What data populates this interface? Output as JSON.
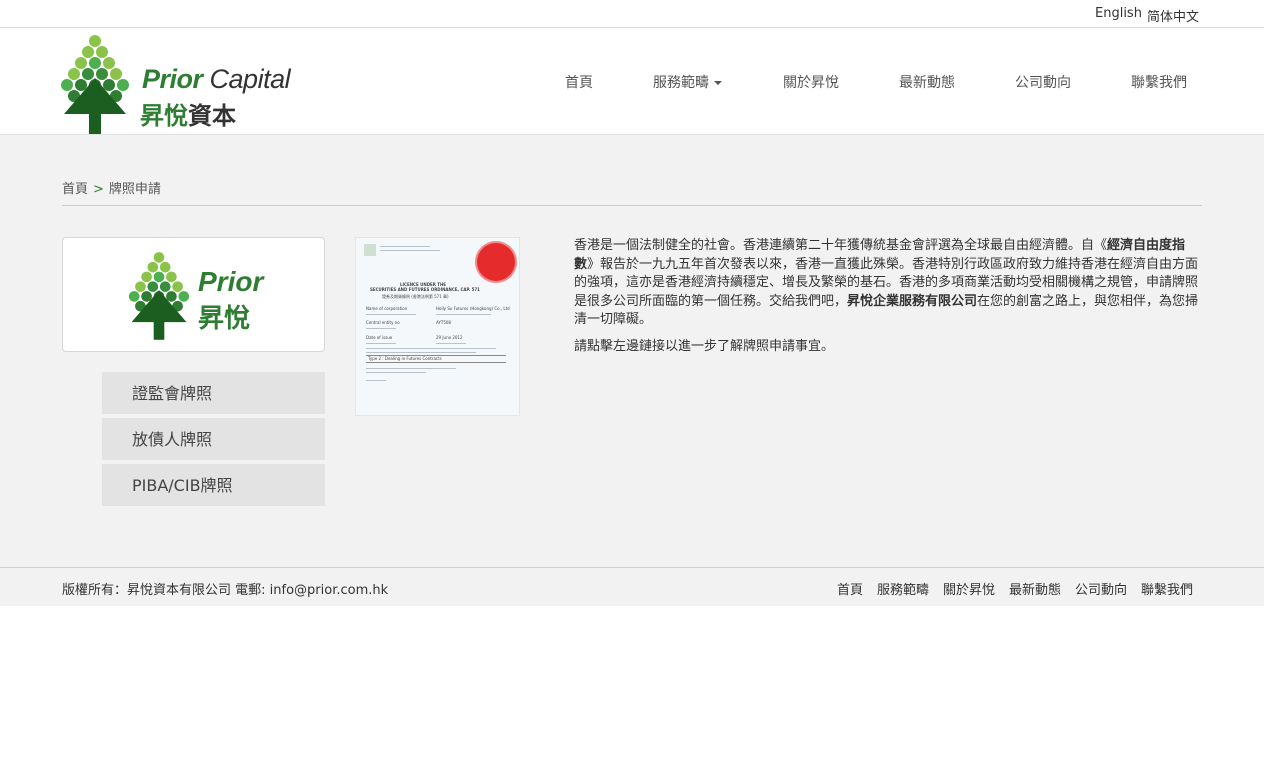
{
  "top_bar": {
    "english": "English",
    "simplified": "简体中文"
  },
  "header": {
    "logo_title": "Prior",
    "logo_title_2": "Capital",
    "logo_cn": "昇悅",
    "logo_cn_2": "資本",
    "nav": [
      "首頁",
      "服務範疇",
      "關於昇悅",
      "最新動態",
      "公司動向",
      "聯繫我們"
    ]
  },
  "breadcrumb": {
    "home": "首頁",
    "separator": ">",
    "current": "牌照申請"
  },
  "side_logo": {
    "title": "Prior",
    "cn": "昇悅"
  },
  "side_menu": [
    "證監會牌照",
    "放債人牌照",
    "PIBA/CIB牌照"
  ],
  "certificate": {
    "heading_1": "LICENCE UNDER THE",
    "heading_2": "SECURITIES AND FUTURES ORDINANCE, CAP. 571",
    "heading_cn": "證券及期貨條例 (香港法例第 571 章)",
    "row_1_label": "Name of corporation",
    "row_1_value": "Holly Su Futures (Hongkong) Co., Ltd",
    "row_2_label": "Central entity no",
    "row_2_value": "AYT508",
    "row_3_label": "Date of issue",
    "row_3_value": "29 June 2012",
    "row_4_label": "Type 2 : Dealing in Futures Contracts"
  },
  "content": {
    "p1_a": " 香港是一個法制健全的社會。香港連續第二十年獲傳統基金會評選為全球最自由經濟體。自《",
    "p1_b": "經濟自由度指數",
    "p1_c": "》報告於一九九五年首次發表以來，香港一直獲此殊榮。香港特別行政區政府致力維持香港在經濟自由方面的強項，這亦是香港經濟持續穩定、增長及繁榮的基石。香港的多項商業活動均受相關機構之規管，申請牌照是很多公司所面臨的第一個任務。交給我們吧，",
    "p1_d": "昇悅企業服務有限公司",
    "p1_e": "在您的創富之路上，與您相伴，為您掃清一切障礙。",
    "p2": "請點擊左邊鏈接以進一步了解牌照申請事宜。"
  },
  "footer": {
    "copyright": "版權所有：昇悅資本有限公司  電郵: info@prior.com.hk",
    "links": [
      "首頁",
      "服務範疇",
      "關於昇悅",
      "最新動態",
      "公司動向",
      "聯繫我們"
    ]
  },
  "colors": {
    "brand_green": "#2e7d32",
    "light_green": "#8bc34a",
    "seal_red": "#e52b2b"
  }
}
